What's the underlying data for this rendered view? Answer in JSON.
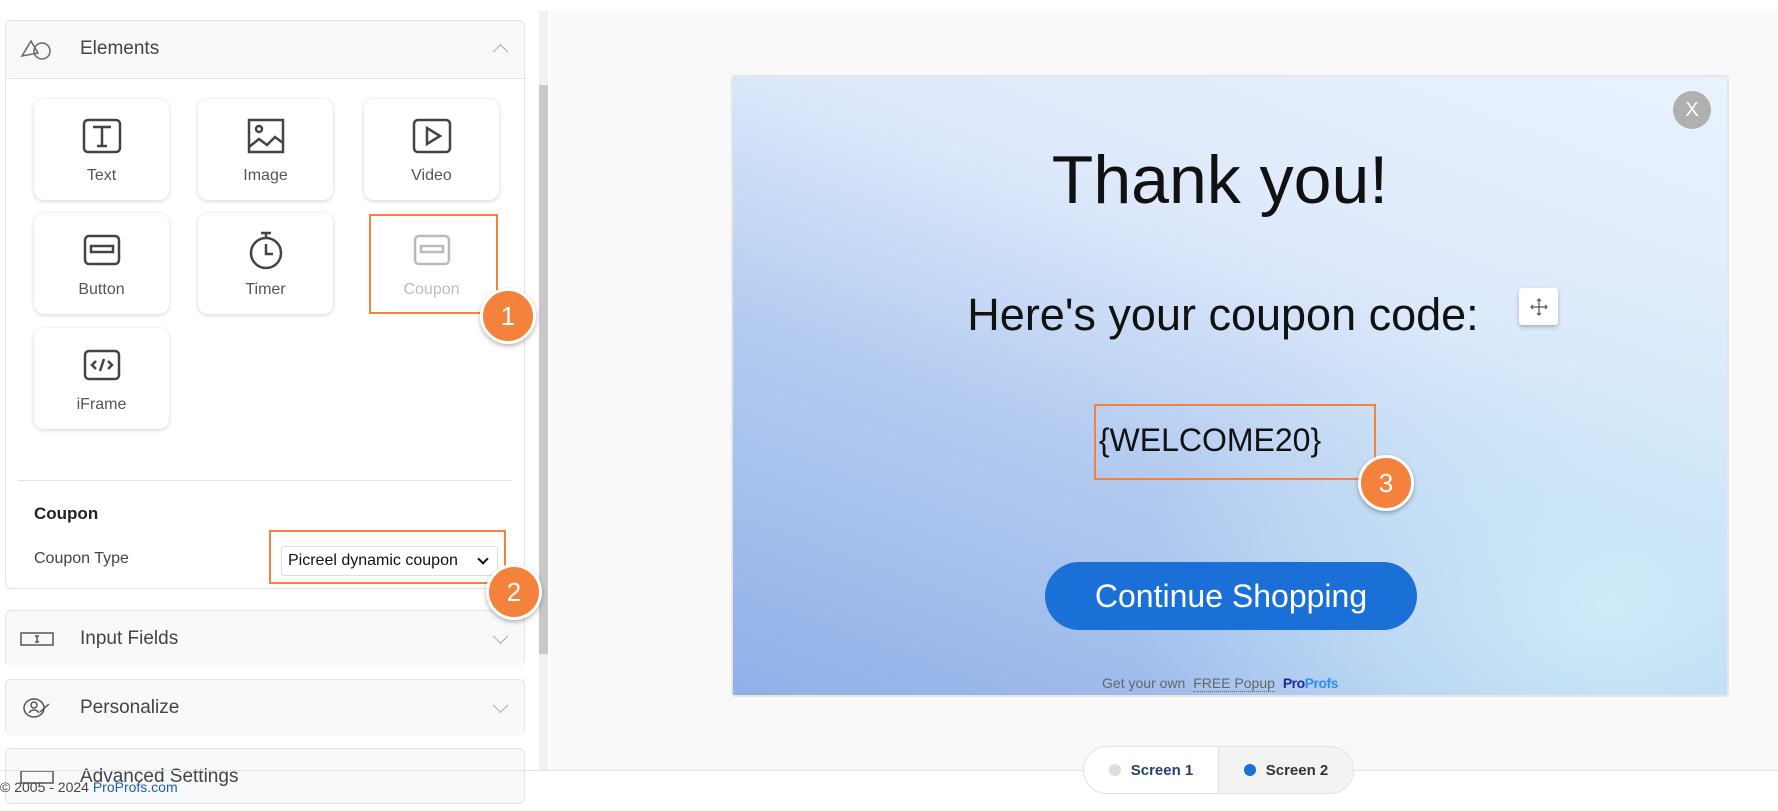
{
  "sidebar": {
    "elements_panel": {
      "title": "Elements",
      "tiles": [
        {
          "label": "Text",
          "icon": "text-icon"
        },
        {
          "label": "Image",
          "icon": "image-icon"
        },
        {
          "label": "Video",
          "icon": "video-icon"
        },
        {
          "label": "Button",
          "icon": "button-icon"
        },
        {
          "label": "Timer",
          "icon": "timer-icon"
        },
        {
          "label": "Coupon",
          "icon": "coupon-icon",
          "selected": true
        },
        {
          "label": "iFrame",
          "icon": "iframe-icon"
        }
      ],
      "section_title": "Coupon",
      "coupon_type_label": "Coupon Type",
      "coupon_type_value": "Picreel dynamic coupon"
    },
    "collapsed_panels": [
      {
        "title": "Input Fields",
        "icon": "input-field-icon"
      },
      {
        "title": "Personalize",
        "icon": "personalize-icon"
      },
      {
        "title": "Advanced Settings",
        "icon": "settings-icon"
      }
    ]
  },
  "annotations": [
    "1",
    "2",
    "3"
  ],
  "accent_color": "#f5823c",
  "popup": {
    "close_label": "X",
    "heading": "Thank you!",
    "subheading": "Here's your coupon code:",
    "coupon_code": "{WELCOME20}",
    "cta_label": "Continue Shopping",
    "cta_color": "#1a70d6",
    "branding_prefix": "Get your own",
    "branding_link": "FREE Popup",
    "branding_logo": "ProProfs"
  },
  "screens": [
    {
      "label": "Screen 1",
      "active": false
    },
    {
      "label": "Screen 2",
      "active": true
    }
  ],
  "footer": {
    "copyright": "© 2005 - 2024",
    "link": "ProProfs.com"
  }
}
